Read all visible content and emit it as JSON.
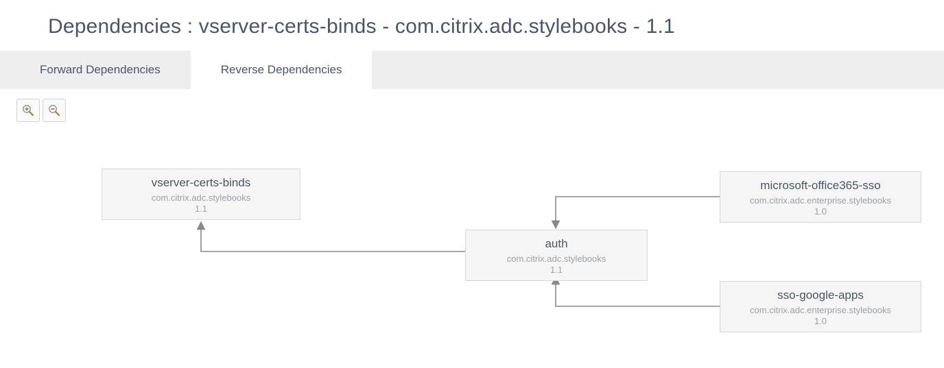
{
  "header": {
    "title": "Dependencies : vserver-certs-binds - com.citrix.adc.stylebooks - 1.1"
  },
  "tabs": {
    "forward": "Forward Dependencies",
    "reverse": "Reverse Dependencies",
    "active": "reverse"
  },
  "toolbar": {
    "zoom_in": "Zoom in",
    "zoom_out": "Zoom out"
  },
  "nodes": {
    "root": {
      "title": "vserver-certs-binds",
      "namespace": "com.citrix.adc.stylebooks",
      "version": "1.1"
    },
    "auth": {
      "title": "auth",
      "namespace": "com.citrix.adc.stylebooks",
      "version": "1.1"
    },
    "o365": {
      "title": "microsoft-office365-sso",
      "namespace": "com.citrix.adc.enterprise.stylebooks",
      "version": "1.0"
    },
    "gapps": {
      "title": "sso-google-apps",
      "namespace": "com.citrix.adc.enterprise.stylebooks",
      "version": "1.0"
    }
  },
  "chart_data": {
    "type": "diagram",
    "diagram_kind": "dependency-graph",
    "direction": "reverse",
    "nodes": [
      {
        "id": "vserver-certs-binds",
        "namespace": "com.citrix.adc.stylebooks",
        "version": "1.1"
      },
      {
        "id": "auth",
        "namespace": "com.citrix.adc.stylebooks",
        "version": "1.1"
      },
      {
        "id": "microsoft-office365-sso",
        "namespace": "com.citrix.adc.enterprise.stylebooks",
        "version": "1.0"
      },
      {
        "id": "sso-google-apps",
        "namespace": "com.citrix.adc.enterprise.stylebooks",
        "version": "1.0"
      }
    ],
    "edges": [
      {
        "from": "auth",
        "to": "vserver-certs-binds"
      },
      {
        "from": "microsoft-office365-sso",
        "to": "auth"
      },
      {
        "from": "sso-google-apps",
        "to": "auth"
      }
    ]
  }
}
